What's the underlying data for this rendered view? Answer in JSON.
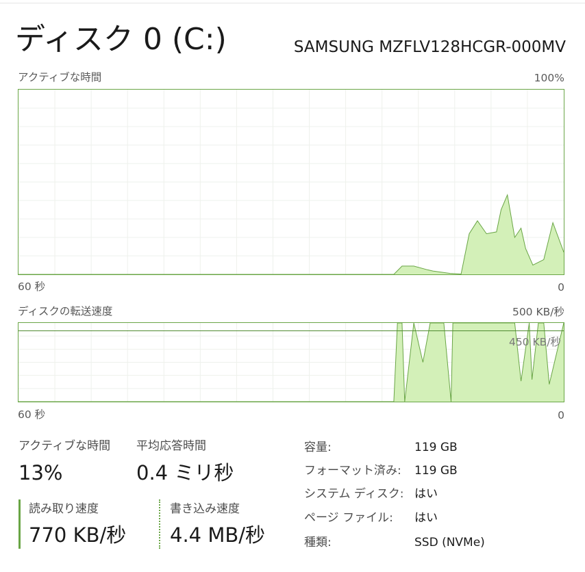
{
  "header": {
    "title": "ディスク 0 (C:)",
    "model": "SAMSUNG MZFLV128HCGR-000MV"
  },
  "active_time_graph": {
    "label": "アクティブな時間",
    "max_label": "100%",
    "left_label": "60 秒",
    "right_label": "0",
    "accent": "#69a545",
    "fill": "#d3f0b8"
  },
  "transfer_graph": {
    "label": "ディスクの転送速度",
    "max_label": "500 KB/秒",
    "line_label": "450 KB/秒",
    "left_label": "60 秒",
    "right_label": "0"
  },
  "stats": {
    "active_time_label": "アクティブな時間",
    "active_time_value": "13%",
    "avg_response_label": "平均応答時間",
    "avg_response_value": "0.4 ミリ秒",
    "read_speed_label": "読み取り速度",
    "read_speed_value": "770 KB/秒",
    "write_speed_label": "書き込み速度",
    "write_speed_value": "4.4 MB/秒"
  },
  "properties": [
    {
      "key": "容量:",
      "value": "119 GB"
    },
    {
      "key": "フォーマット済み:",
      "value": "119 GB"
    },
    {
      "key": "システム ディスク:",
      "value": "はい"
    },
    {
      "key": "ページ ファイル:",
      "value": "はい"
    },
    {
      "key": "種類:",
      "value": "SSD (NVMe)"
    }
  ],
  "chart_data": [
    {
      "type": "area",
      "title": "アクティブな時間",
      "xlabel": "",
      "ylabel": "",
      "x": [
        60,
        55,
        50,
        45,
        40,
        35,
        30,
        25,
        20,
        18.7,
        17.8,
        16.5,
        15,
        14.4,
        12.5,
        11.3,
        10.4,
        9.5,
        8.5,
        7.4,
        6.9,
        6.2,
        5.4,
        4.7,
        4.2,
        3.4,
        2.2,
        1.2,
        0
      ],
      "values": [
        0,
        0,
        0,
        0,
        0,
        0,
        0,
        0,
        0,
        0,
        4.5,
        4.5,
        2.5,
        1.8,
        0.5,
        0.2,
        22,
        29,
        22,
        23,
        35,
        43,
        20,
        25,
        14,
        5,
        8,
        28,
        12
      ],
      "ylim": [
        0,
        100
      ],
      "xlim": [
        60,
        0
      ],
      "grid": true
    },
    {
      "type": "area",
      "title": "ディスクの転送速度",
      "xlabel": "",
      "ylabel": "",
      "x": [
        60,
        55,
        50,
        45,
        40,
        35,
        30,
        25,
        20,
        18.7,
        18.3,
        17.8,
        17.5,
        16.5,
        15.5,
        14.7,
        13.2,
        12.4,
        12.2,
        11.2,
        10.2,
        6.2,
        5.4,
        4.7,
        3.8,
        3.5,
        2.8,
        2.2,
        1.6,
        0
      ],
      "values": [
        0,
        0,
        0,
        0,
        0,
        0,
        0,
        0,
        0,
        0,
        500,
        500,
        0,
        500,
        250,
        500,
        500,
        0,
        500,
        500,
        500,
        500,
        500,
        130,
        500,
        140,
        500,
        500,
        110,
        500
      ],
      "reference_line": 450,
      "ylim": [
        0,
        500
      ],
      "xlim": [
        60,
        0
      ],
      "grid": true
    }
  ]
}
